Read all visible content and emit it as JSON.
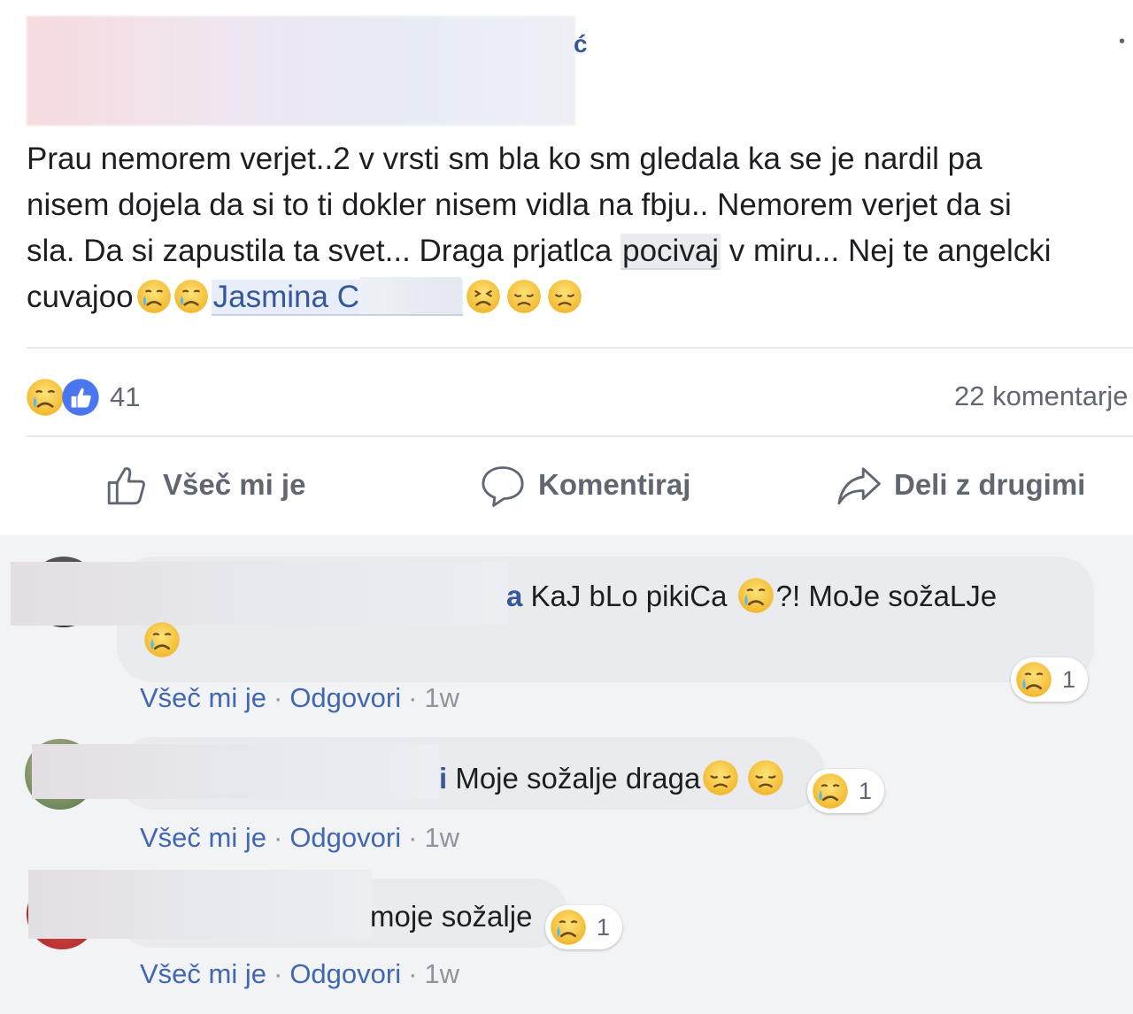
{
  "post": {
    "author_tail": "ć",
    "more": "•",
    "text": {
      "line1": "Prau nemorem verjet..2 v vrsti sm bla ko sm gledala ka se je nardil pa",
      "line2": "nisem dojela da si to ti dokler nisem vidla na fbju.. Nemorem verjet da si",
      "line3_a": "sla. Da si zapustila ta svet... Draga prjatlca ",
      "line3_hl": "pocivaj",
      "line3_b": " v miru... Nej te angelcki",
      "line4_a": "cuvajoo",
      "mention": "Jasmina C"
    },
    "reaction_count": "41",
    "comment_count": "22 komentarje",
    "actions": {
      "like": "Všeč mi je",
      "comment": "Komentiraj",
      "share": "Deli z drugimi"
    }
  },
  "comments": [
    {
      "name_tail": "a",
      "text_a": " KaJ bLo pikiCa ",
      "text_b": "?! MoJe sožaLJe",
      "reaction_count": "1",
      "like": "Všeč mi je",
      "reply": "Odgovori",
      "time": "1w"
    },
    {
      "name_tail": "i",
      "text_a": " Moje sožalje draga",
      "reaction_count": "1",
      "like": "Všeč mi je",
      "reply": "Odgovori",
      "time": "1w"
    },
    {
      "text_a": "moje sožalje",
      "reaction_count": "1",
      "like": "Všeč mi je",
      "reply": "Odgovori",
      "time": "1w"
    }
  ],
  "icons": {
    "cry": "crying-face-icon",
    "persevere": "persevering-face-icon",
    "sad": "disappointed-face-icon",
    "like": "thumbs-up-icon",
    "comment": "speech-bubble-icon",
    "share": "share-arrow-icon"
  },
  "colors": {
    "link": "#365899",
    "like_blue": "#4267b2",
    "emoji_yellow": "#f7c23a",
    "secondary_text": "#606770"
  }
}
